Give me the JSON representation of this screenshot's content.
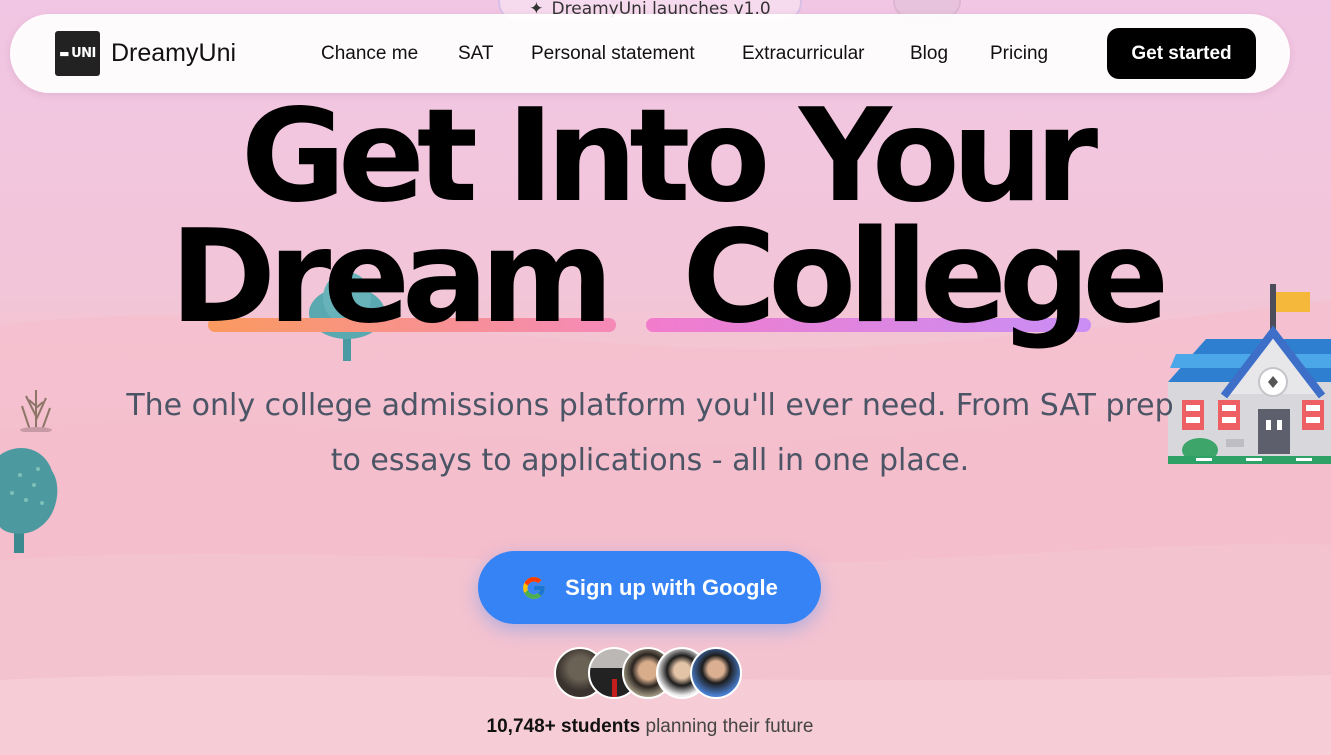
{
  "announcement": {
    "text": "DreamyUni launches v1.0",
    "icon": "sparkle-icon"
  },
  "nav": {
    "logo_text": "UNI",
    "brand": "DreamyUni",
    "links": [
      "Chance me",
      "SAT",
      "Personal statement",
      "Extracurricular",
      "Blog",
      "Pricing"
    ],
    "cta_label": "Get started"
  },
  "hero": {
    "line1": "Get Into Your",
    "line2_word1": "Dream",
    "line2_word2": "College",
    "subtitle_line1": "The only college admissions platform you'll ever need. From SAT prep",
    "subtitle_line2": "to essays to applications - all in one place.",
    "google_button_label": "Sign up with Google",
    "social_proof_count": "10,748+ students",
    "social_proof_rest": " planning their future"
  },
  "colors": {
    "cta_bg": "#000000",
    "google_button_bg": "#3583f5",
    "underline_dream": [
      "#fa9a5f",
      "#f58ab9"
    ],
    "underline_college": [
      "#f27ccc",
      "#c98ef5"
    ],
    "subtitle_text": "#4c5566"
  }
}
